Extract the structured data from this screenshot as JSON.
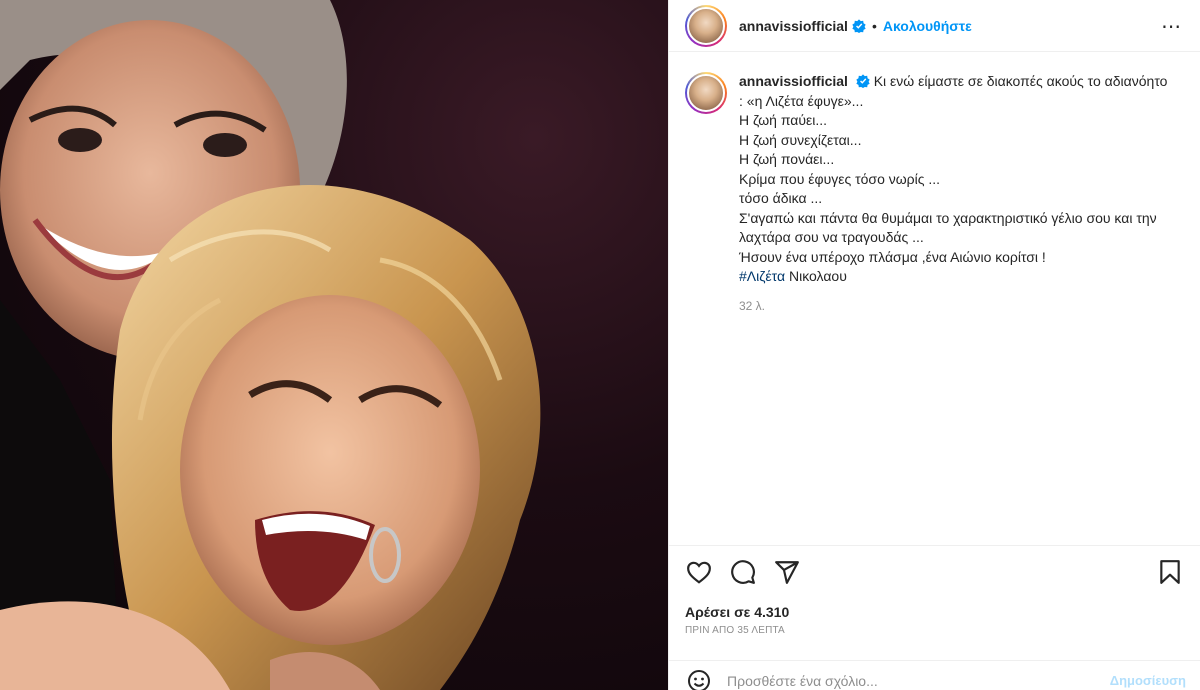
{
  "post": {
    "username": "annavissiofficial",
    "verified_icon": "verified-badge-icon",
    "separator": "•",
    "follow_label": "Ακολουθήστε",
    "more_icon": "more-options-icon"
  },
  "caption": {
    "username": "annavissiofficial",
    "lines": [
      "Κι ενώ είμαστε σε διακοπές ακούς το αδιανόητο : «η Λιζέτα έφυγε»...",
      "Η ζωή παύει...",
      "Η ζωή συνεχίζεται...",
      "Η ζωή πονάει...",
      "Κρίμα που έφυγες τόσο νωρίς ...",
      "τόσο άδικα ...",
      "Σ'αγαπώ και πάντα θα θυμάμαι το χαρακτηριστικό γέλιο σου και την λαχτάρα σου να τραγουδάς ...",
      "Ήσουν ένα υπέροχο πλάσμα ,ένα Αιώνιο κορίτσι !"
    ],
    "hashtag": "#Λιζέτα",
    "hashtag_rest": " Νικολαου",
    "age": "32 λ."
  },
  "actions": {
    "like_icon": "heart-icon",
    "comment_icon": "comment-icon",
    "share_icon": "share-icon",
    "save_icon": "bookmark-icon"
  },
  "likes_label": "Αρέσει σε 4.310",
  "posted_time": "ΠΡΙΝ ΑΠΟ 35 ΛΕΠΤΑ",
  "comment": {
    "placeholder": "Προσθέστε ένα σχόλιο...",
    "post_label": "Δημοσίευση",
    "emoji_icon": "emoji-icon"
  },
  "colors": {
    "accent": "#0095f6",
    "hashtag": "#00376b",
    "muted": "#8e8e8e",
    "post_disabled": "#b2dffc"
  }
}
